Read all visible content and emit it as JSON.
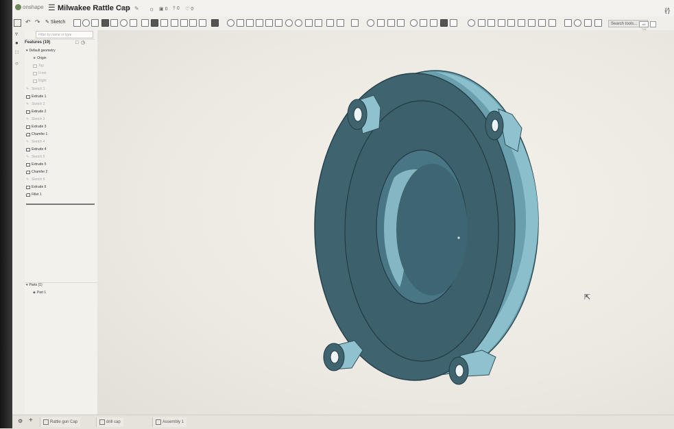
{
  "app": {
    "logo_text": "onshape",
    "document_title": "Milwakee Rattle Cap",
    "workspace": "Main",
    "counters": [
      "0",
      "0",
      "0"
    ]
  },
  "toolbar": {
    "sketch_label": "Sketch",
    "search_placeholder": "Search tools...",
    "search_shortcut": "alt/⌥C"
  },
  "feature_panel": {
    "filter_placeholder": "Filter by name or type",
    "features_header": "Features (19)",
    "default_geometry": "Default geometry",
    "geometry_items": [
      "Origin",
      "Top",
      "Front",
      "Right"
    ],
    "features": [
      {
        "label": "Sketch 1",
        "kind": "sketch"
      },
      {
        "label": "Extrude 1",
        "kind": "extrude"
      },
      {
        "label": "Sketch 2",
        "kind": "sketch"
      },
      {
        "label": "Extrude 2",
        "kind": "extrude"
      },
      {
        "label": "Sketch 3",
        "kind": "sketch"
      },
      {
        "label": "Extrude 3",
        "kind": "extrude"
      },
      {
        "label": "Chamfer 1",
        "kind": "chamfer"
      },
      {
        "label": "Sketch 4",
        "kind": "sketch"
      },
      {
        "label": "Extrude 4",
        "kind": "extrude"
      },
      {
        "label": "Sketch 5",
        "kind": "sketch"
      },
      {
        "label": "Extrude 5",
        "kind": "extrude"
      },
      {
        "label": "Chamfer 2",
        "kind": "chamfer"
      },
      {
        "label": "Sketch 6",
        "kind": "sketch"
      },
      {
        "label": "Extrude 6",
        "kind": "extrude"
      },
      {
        "label": "Fillet 1",
        "kind": "fillet"
      }
    ],
    "parts_header": "Parts (1)",
    "parts": [
      "Part 1"
    ]
  },
  "tabs": [
    {
      "label": "Rattle gun Cap"
    },
    {
      "label": "drill cap"
    },
    {
      "label": "Assembly 1"
    }
  ],
  "colors": {
    "model_face": "#3f6470",
    "model_light": "#8fc2ce",
    "model_rim": "#6fa5b3"
  }
}
